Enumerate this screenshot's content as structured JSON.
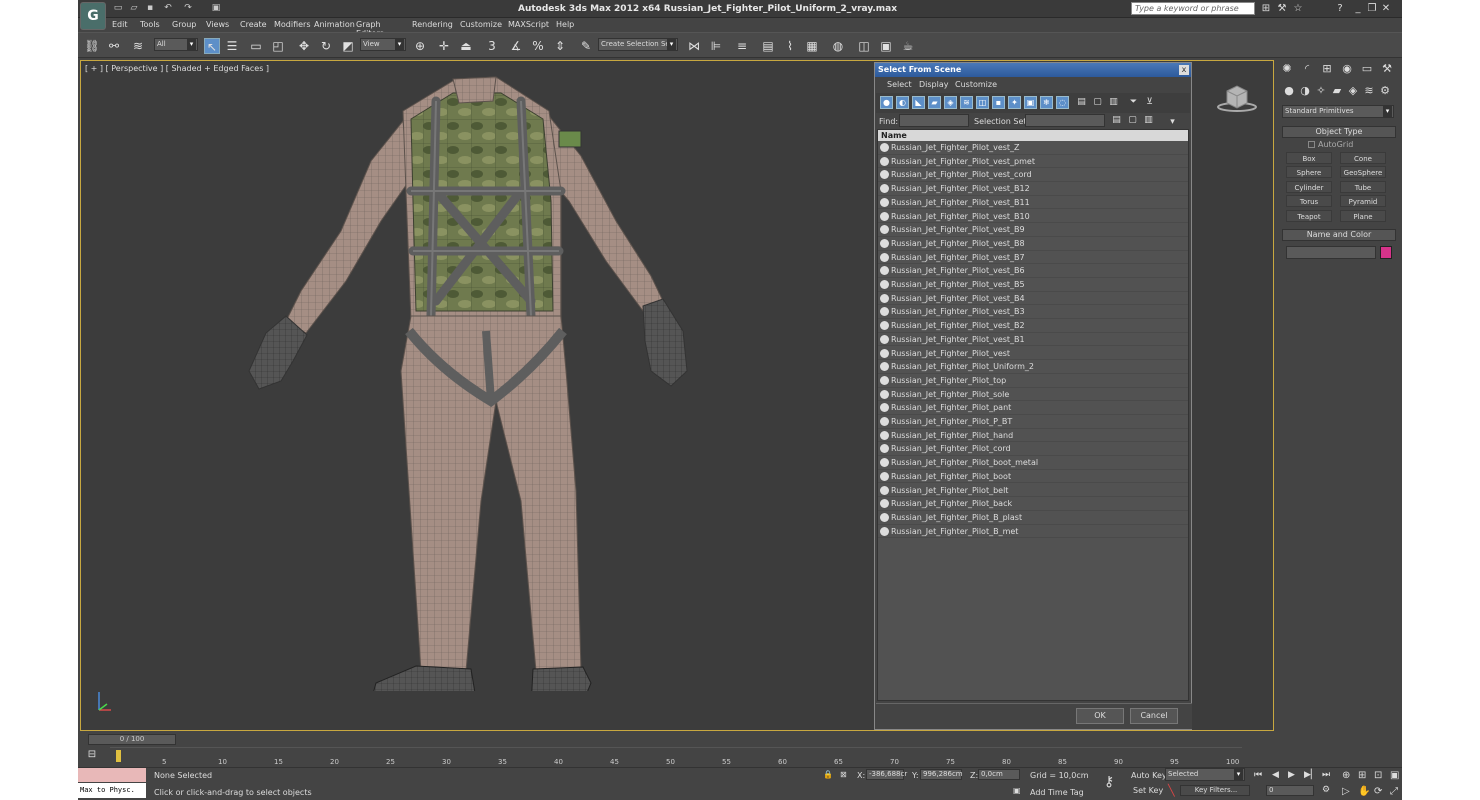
{
  "app": {
    "logo": "G",
    "title": "Autodesk 3ds Max  2012 x64     Russian_Jet_Fighter_Pilot_Uniform_2_vray.max",
    "search_placeholder": "Type a keyword or phrase"
  },
  "menu": [
    "Edit",
    "Tools",
    "Group",
    "Views",
    "Create",
    "Modifiers",
    "Animation",
    "Graph Editors",
    "Rendering",
    "Customize",
    "MAXScript",
    "Help"
  ],
  "toolbar": {
    "filter_value": "All",
    "refcoord_value": "View",
    "selection_set_placeholder": "Create Selection Se"
  },
  "viewport": {
    "label": "[ + ] [ Perspective ] [ Shaded + Edged Faces ]"
  },
  "dialog": {
    "title": "Select From Scene",
    "close": "x",
    "menu": [
      "Select",
      "Display",
      "Customize"
    ],
    "find_label": "Find:",
    "selection_set_label": "Selection Set:",
    "column_name": "Name",
    "items": [
      "Russian_Jet_Fighter_Pilot_vest_Z",
      "Russian_Jet_Fighter_Pilot_vest_pmet",
      "Russian_Jet_Fighter_Pilot_vest_cord",
      "Russian_Jet_Fighter_Pilot_vest_B12",
      "Russian_Jet_Fighter_Pilot_vest_B11",
      "Russian_Jet_Fighter_Pilot_vest_B10",
      "Russian_Jet_Fighter_Pilot_vest_B9",
      "Russian_Jet_Fighter_Pilot_vest_B8",
      "Russian_Jet_Fighter_Pilot_vest_B7",
      "Russian_Jet_Fighter_Pilot_vest_B6",
      "Russian_Jet_Fighter_Pilot_vest_B5",
      "Russian_Jet_Fighter_Pilot_vest_B4",
      "Russian_Jet_Fighter_Pilot_vest_B3",
      "Russian_Jet_Fighter_Pilot_vest_B2",
      "Russian_Jet_Fighter_Pilot_vest_B1",
      "Russian_Jet_Fighter_Pilot_vest",
      "Russian_Jet_Fighter_Pilot_Uniform_2",
      "Russian_Jet_Fighter_Pilot_top",
      "Russian_Jet_Fighter_Pilot_sole",
      "Russian_Jet_Fighter_Pilot_pant",
      "Russian_Jet_Fighter_Pilot_P_BT",
      "Russian_Jet_Fighter_Pilot_hand",
      "Russian_Jet_Fighter_Pilot_cord",
      "Russian_Jet_Fighter_Pilot_boot_metal",
      "Russian_Jet_Fighter_Pilot_boot",
      "Russian_Jet_Fighter_Pilot_belt",
      "Russian_Jet_Fighter_Pilot_back",
      "Russian_Jet_Fighter_Pilot_B_plast",
      "Russian_Jet_Fighter_Pilot_B_met"
    ],
    "ok": "OK",
    "cancel": "Cancel"
  },
  "command_panel": {
    "category": "Standard Primitives",
    "object_type_title": "Object Type",
    "autogrid": "AutoGrid",
    "primitives": [
      "Box",
      "Cone",
      "Sphere",
      "GeoSphere",
      "Cylinder",
      "Tube",
      "Torus",
      "Pyramid",
      "Teapot",
      "Plane"
    ],
    "name_color_title": "Name and Color",
    "color": "#d6338a"
  },
  "timeline": {
    "slider": "0 / 100",
    "ticks": [
      "5",
      "10",
      "15",
      "20",
      "25",
      "30",
      "35",
      "40",
      "45",
      "50",
      "55",
      "60",
      "65",
      "70",
      "75",
      "80",
      "85",
      "90",
      "95",
      "100"
    ]
  },
  "status": {
    "listener": "Max to Physc.",
    "selection": "None Selected",
    "prompt": "Click or click-and-drag to select objects",
    "x_label": "X:",
    "x": "-386,688cr",
    "y_label": "Y:",
    "y": "996,286cm",
    "z_label": "Z:",
    "z": "0,0cm",
    "grid": "Grid = 10,0cm",
    "add_time_tag": "Add Time Tag",
    "auto_key": "Auto Key",
    "auto_key_value": "Selected",
    "set_key": "Set Key",
    "key_filters": "Key Filters...",
    "frame": "0"
  }
}
